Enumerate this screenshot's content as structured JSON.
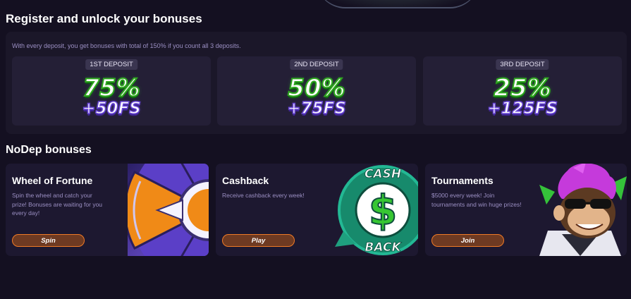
{
  "register": {
    "title": "Register and unlock your bonuses",
    "intro": "With every deposit, you get bonuses with total of 150% if you count all 3 deposits.",
    "deposits": [
      {
        "badge": "1ST DEPOSIT",
        "percent": "75%",
        "spins": "+50FS"
      },
      {
        "badge": "2ND DEPOSIT",
        "percent": "50%",
        "spins": "+75FS"
      },
      {
        "badge": "3RD DEPOSIT",
        "percent": "25%",
        "spins": "+125FS"
      }
    ]
  },
  "nodep": {
    "title": "NoDep bonuses",
    "cards": [
      {
        "title": "Wheel of Fortune",
        "desc_lines": [
          "Spin the wheel and catch your",
          "prize! Bonuses are waiting for you",
          "every day!"
        ],
        "button": "Spin",
        "art": "wheel-icon"
      },
      {
        "title": "Cashback",
        "desc_lines": [
          "Receive cashback every week!"
        ],
        "button": "Play",
        "art": "cashback-icon",
        "art_text_top": "CASH",
        "art_text_bottom": "BACK"
      },
      {
        "title": "Tournaments",
        "desc_lines": [
          "$5000 every week! Join",
          "tournaments and win huge prizes!"
        ],
        "button": "Join",
        "art": "monkey-mascot-icon"
      }
    ]
  },
  "colors": {
    "background": "#141021",
    "panel": "#1b1729",
    "card": "#241f36",
    "percent_outline": "#2fa81f",
    "spins_outline": "#6a46d8",
    "button_border": "#f07a26",
    "button_fill": "#6e3a22",
    "muted_text": "#9b8fc3"
  }
}
